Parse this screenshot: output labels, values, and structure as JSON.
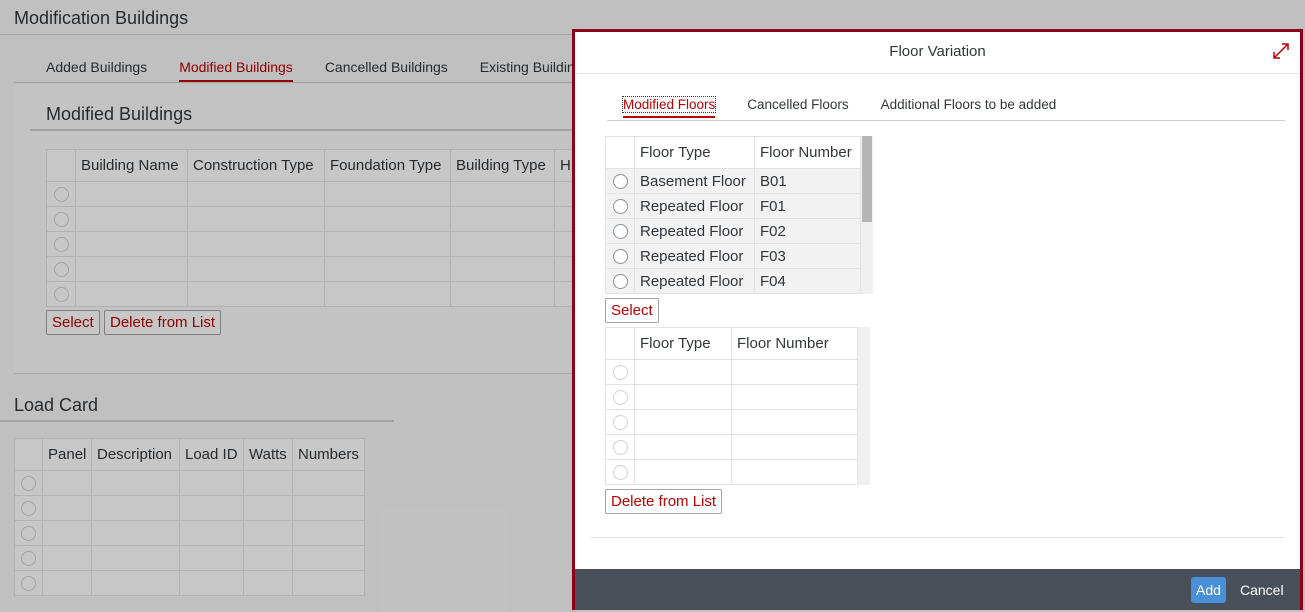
{
  "page": {
    "title": "Modification Buildings",
    "tabs": [
      "Added Buildings",
      "Modified Buildings",
      "Cancelled Buildings",
      "Existing Buildin"
    ]
  },
  "modified_buildings": {
    "title": "Modified Buildings",
    "columns": [
      "Building Name",
      "Construction Type",
      "Foundation Type",
      "Building Type",
      "H"
    ],
    "select_label": "Select",
    "delete_label": "Delete from List"
  },
  "load_card": {
    "title": "Load Card",
    "columns": [
      "Panel",
      "Description",
      "Load ID",
      "Watts",
      "Numbers"
    ]
  },
  "dialog": {
    "title": "Floor Variation",
    "tabs": [
      "Modified Floors",
      "Cancelled Floors",
      "Additional Floors to be added"
    ],
    "source_table": {
      "columns": [
        "Floor Type",
        "Floor Number"
      ],
      "rows": [
        [
          "Basement Floor",
          "B01"
        ],
        [
          "Repeated Floor",
          "F01"
        ],
        [
          "Repeated Floor",
          "F02"
        ],
        [
          "Repeated Floor",
          "F03"
        ],
        [
          "Repeated Floor",
          "F04"
        ]
      ]
    },
    "select_label": "Select",
    "target_table": {
      "columns": [
        "Floor Type",
        "Floor Number"
      ]
    },
    "delete_label": "Delete from List",
    "footer": {
      "add_label": "Add",
      "cancel_label": "Cancel"
    },
    "colors": {
      "accent": "#bb0000",
      "frame": "#8b0018",
      "footer": "#495059",
      "primary": "#4a90d9"
    }
  }
}
